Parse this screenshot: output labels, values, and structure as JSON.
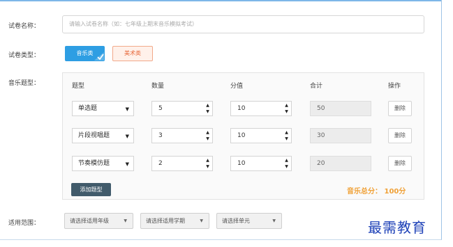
{
  "form": {
    "name_label": "试卷名称：",
    "name_placeholder": "请输入试卷名称（如：七年级上期末音乐模拟考试）",
    "type_label": "试卷类型：",
    "type_options": [
      {
        "label": "音乐类",
        "selected": true
      },
      {
        "label": "美术类",
        "selected": false
      }
    ],
    "question_types_label": "音乐题型："
  },
  "table": {
    "headers": [
      "题型",
      "数量",
      "分值",
      "合计",
      "操作"
    ],
    "rows": [
      {
        "type": "单选题",
        "quantity": "5",
        "score": "10",
        "total": "50",
        "action": "删除"
      },
      {
        "type": "片段视唱题",
        "quantity": "3",
        "score": "10",
        "total": "30",
        "action": "删除"
      },
      {
        "type": "节奏模仿题",
        "quantity": "2",
        "score": "10",
        "total": "20",
        "action": "删除"
      }
    ],
    "add_button": "添加题型",
    "total_summary": "音乐总分： 100分"
  },
  "scope": {
    "label": "适用范围：",
    "selects": [
      "请选择适用年级",
      "请选择适用学期",
      "请选择单元"
    ]
  },
  "watermark": "最需教育",
  "colors": {
    "accent": "#2e9ee3",
    "art_button_text": "#e7683a",
    "add_button_bg": "#415b6b",
    "total_text": "#f0a137",
    "watermark": "#2043b8"
  }
}
